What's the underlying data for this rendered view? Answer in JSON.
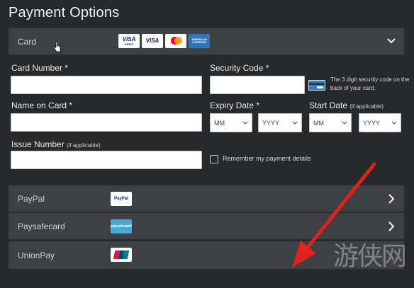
{
  "page": {
    "title": "Payment Options"
  },
  "card_section": {
    "label": "Card",
    "logos": [
      {
        "name": "visa-debit",
        "text": "VISA",
        "sub": "DEBIT"
      },
      {
        "name": "visa",
        "text": "VISA"
      },
      {
        "name": "mastercard",
        "text": ""
      },
      {
        "name": "american-express",
        "text": "AMERICAN EXPRESS"
      }
    ]
  },
  "form": {
    "card_number": {
      "label": "Card Number *",
      "value": "",
      "placeholder": ""
    },
    "security_code": {
      "label": "Security Code *",
      "value": "",
      "placeholder": "",
      "help": "The 3 digit security code on the back of your card."
    },
    "name_on_card": {
      "label": "Name on Card *",
      "value": "",
      "placeholder": ""
    },
    "expiry_date": {
      "label": "Expiry Date *",
      "month": "MM",
      "year": "YYYY"
    },
    "start_date": {
      "label": "Start Date",
      "note": "(if applicable)",
      "month": "MM",
      "year": "YYYY"
    },
    "issue_number": {
      "label": "Issue Number",
      "note": "(if applicable)",
      "value": "",
      "placeholder": ""
    },
    "remember": {
      "label": "Remember my payment details",
      "checked": false
    }
  },
  "payment_methods": [
    {
      "label": "PayPal",
      "logo_text": "PayPal"
    },
    {
      "label": "Paysafecard",
      "logo_text": "paysafecard"
    },
    {
      "label": "UnionPay",
      "logo_text": "UnionPay"
    }
  ],
  "watermark": {
    "text": "游侠网"
  },
  "colors": {
    "background": "#28292b",
    "bar": "#3f4043",
    "annotation_arrow": "#e0221a"
  }
}
